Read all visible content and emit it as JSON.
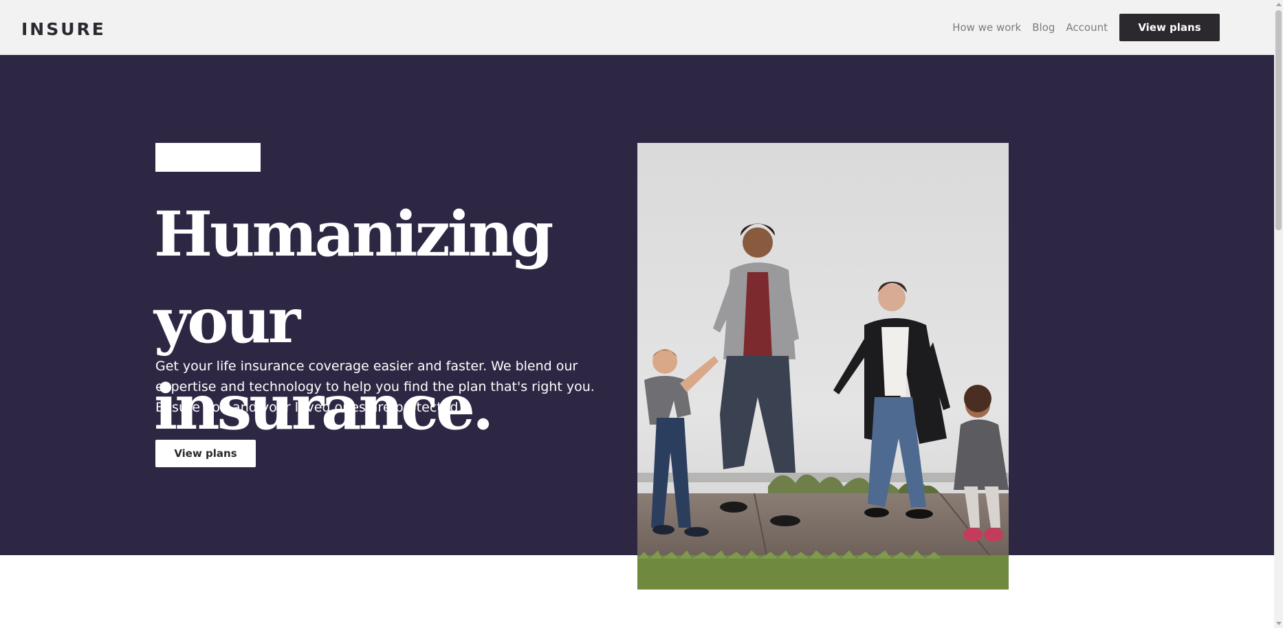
{
  "header": {
    "logo": "INSURE",
    "nav": [
      "How we work",
      "Blog",
      "Account"
    ],
    "cta_label": "View plans"
  },
  "hero": {
    "title_line1": "Humanizing",
    "title_line2": "your insurance.",
    "description": "Get your life insurance coverage easier and faster. We blend our expertise and technology to help you find the plan that's right you. Ensure you and your loved ones are protected.",
    "cta_label": "View plans",
    "image": "family-walking-photo",
    "background_color": "#2e2744"
  },
  "colors": {
    "header_bg": "#f2f2f2",
    "dark": "#2b282e",
    "hero_bg": "#2e2744",
    "nav_text": "#7d7a82"
  },
  "scrollbar": {
    "up_icon": "scroll-up-arrow-icon",
    "down_icon": "scroll-down-arrow-icon"
  }
}
